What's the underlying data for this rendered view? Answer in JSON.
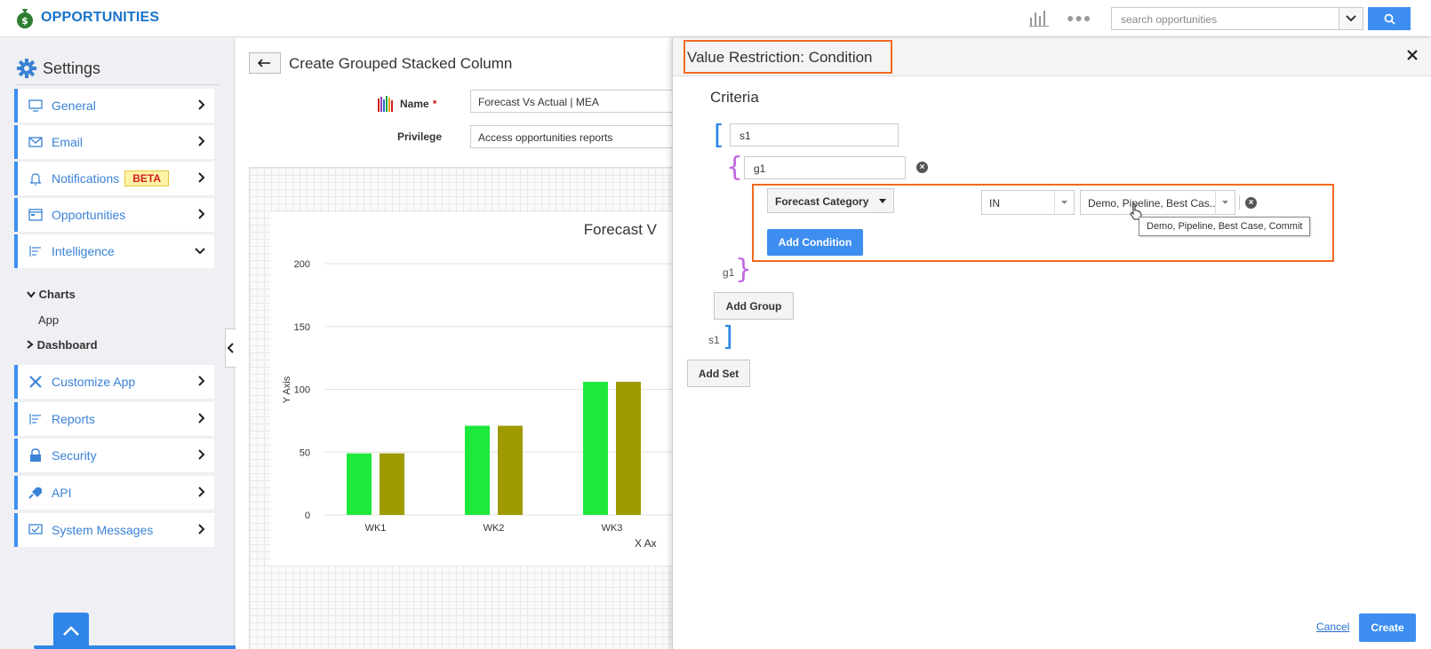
{
  "app": {
    "title": "OPPORTUNITIES"
  },
  "search": {
    "placeholder": "search opportunities"
  },
  "sidebar": {
    "title": "Settings",
    "items": [
      {
        "label": "General",
        "icon": "monitor-icon"
      },
      {
        "label": "Email",
        "icon": "envelope-icon"
      },
      {
        "label": "Notifications",
        "icon": "bell-icon",
        "badge": "BETA"
      },
      {
        "label": "Opportunities",
        "icon": "board-icon"
      },
      {
        "label": "Intelligence",
        "icon": "bars-icon",
        "expanded": true
      }
    ],
    "sub": {
      "charts": "Charts",
      "app": "App",
      "dashboard": "Dashboard"
    },
    "items2": [
      {
        "label": "Customize App",
        "icon": "tools-icon"
      },
      {
        "label": "Reports",
        "icon": "list-icon"
      },
      {
        "label": "Security",
        "icon": "lock-icon"
      },
      {
        "label": "API",
        "icon": "plug-icon"
      },
      {
        "label": "System Messages",
        "icon": "message-icon"
      }
    ]
  },
  "main": {
    "title": "Create Grouped Stacked Column",
    "name_label": "Name",
    "name_value": "Forecast Vs Actual | MEA",
    "privilege_label": "Privilege",
    "privilege_value": "Access opportunities reports"
  },
  "chart_data": {
    "type": "bar",
    "title": "Forecast V",
    "categories": [
      "WK1",
      "WK2",
      "WK3"
    ],
    "series": [
      {
        "values": [
          49,
          71,
          106
        ],
        "color": "#1ee83c"
      },
      {
        "values": [
          49,
          71,
          106
        ],
        "color": "#9e9a00"
      }
    ],
    "ylabel": "Y Axis",
    "xlabel": "X Ax",
    "ylim": [
      0,
      200
    ],
    "yticks": [
      0,
      50,
      100,
      150,
      200
    ]
  },
  "panel": {
    "title": "Value Restriction: Condition",
    "criteria": "Criteria",
    "set_name": "s1",
    "group_name": "g1",
    "condition": {
      "field": "Forecast Category",
      "operator": "IN",
      "value": "Demo, Pipeline, Best Cas..",
      "tooltip": "Demo, Pipeline, Best Case, Commit"
    },
    "add_condition": "Add Condition",
    "group_close": "g1",
    "add_group": "Add Group",
    "set_close": "s1",
    "add_set": "Add Set",
    "cancel": "Cancel",
    "create": "Create"
  },
  "colors": {
    "accent": "#3d8ef0",
    "highlight": "#f06a20",
    "set_bracket": "#2f86e8",
    "group_bracket": "#c069e0"
  }
}
